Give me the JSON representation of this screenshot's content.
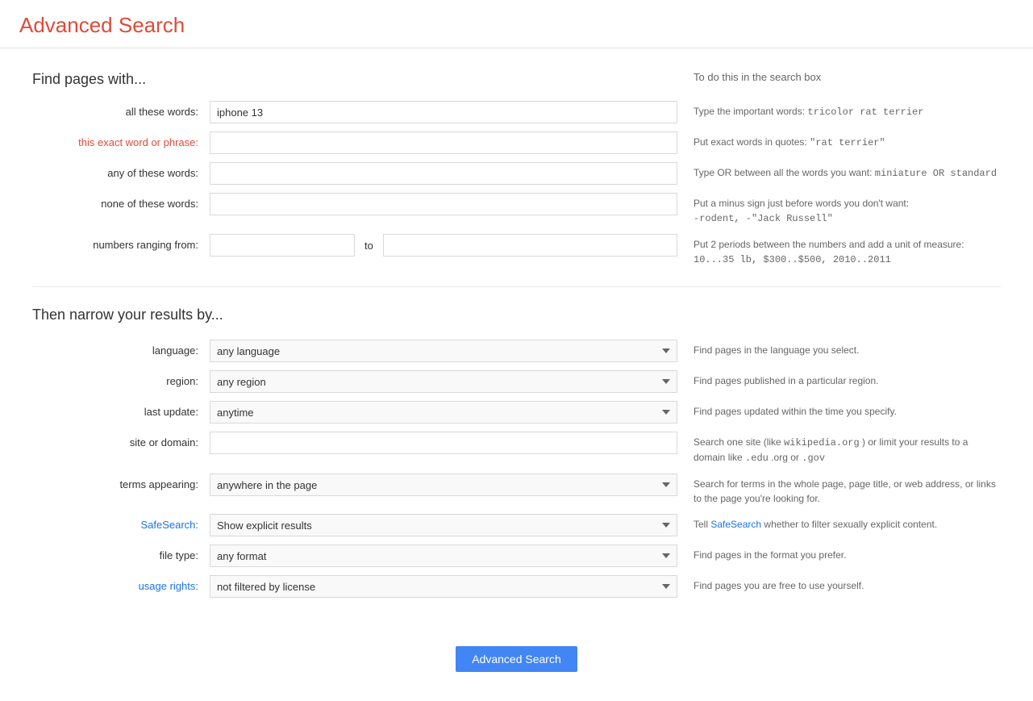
{
  "header": {
    "title": "Advanced Search"
  },
  "find_pages": {
    "title": "Find pages with...",
    "to_do_title": "To do this in the search box"
  },
  "fields": {
    "all_these_words": {
      "label": "all these words:",
      "value": "iphone 13",
      "placeholder": "",
      "hint_text": "Type the important words:",
      "hint_example": "tricolor rat terrier"
    },
    "exact_word": {
      "label": "this exact word or phrase:",
      "value": "",
      "placeholder": "",
      "hint_text": "Put exact words in quotes:",
      "hint_example": "\"rat terrier\""
    },
    "any_of_these": {
      "label": "any of these words:",
      "value": "",
      "placeholder": "",
      "hint_text": "Type OR between all the words you want:",
      "hint_example": "miniature OR standard"
    },
    "none_of_these": {
      "label": "none of these words:",
      "value": "",
      "placeholder": "",
      "hint_text": "Put a minus sign just before words you don't want:",
      "hint_example": "-rodent, -\"Jack Russell\""
    },
    "numbers_from": {
      "label": "numbers ranging from:",
      "value_from": "",
      "value_to": "",
      "to_label": "to",
      "hint_text": "Put 2 periods between the numbers and add a unit of measure:",
      "hint_example": "10...35 lb, $300..$500, 2010..2011"
    }
  },
  "narrow_results": {
    "title": "Then narrow your results by..."
  },
  "dropdowns": {
    "language": {
      "label": "language:",
      "value": "any language",
      "hint": "Find pages in the language you select."
    },
    "region": {
      "label": "region:",
      "value": "any region",
      "hint": "Find pages published in a particular region."
    },
    "last_update": {
      "label": "last update:",
      "value": "anytime",
      "hint": "Find pages updated within the time you specify."
    },
    "site_or_domain": {
      "label": "site or domain:",
      "value": "",
      "hint_prefix": "Search one site (like",
      "hint_wiki": "wikipedia.org",
      "hint_middle": ") or limit your results to a domain like",
      "hint_edu": ".edu",
      "hint_org": ".org",
      "hint_or": "or",
      "hint_gov": ".gov"
    },
    "terms_appearing": {
      "label": "terms appearing:",
      "value": "anywhere in the page",
      "hint": "Search for terms in the whole page, page title, or web address, or links to the page you're looking for."
    },
    "safesearch": {
      "label": "SafeSearch:",
      "value": "Show explicit results",
      "hint_prefix": "Tell",
      "hint_link": "SafeSearch",
      "hint_suffix": "whether to filter sexually explicit content."
    },
    "file_type": {
      "label": "file type:",
      "value": "any format",
      "hint": "Find pages in the format you prefer."
    },
    "usage_rights": {
      "label": "usage rights:",
      "value": "not filtered by license",
      "hint": "Find pages you are free to use yourself."
    }
  },
  "buttons": {
    "advanced_search": "Advanced Search"
  }
}
